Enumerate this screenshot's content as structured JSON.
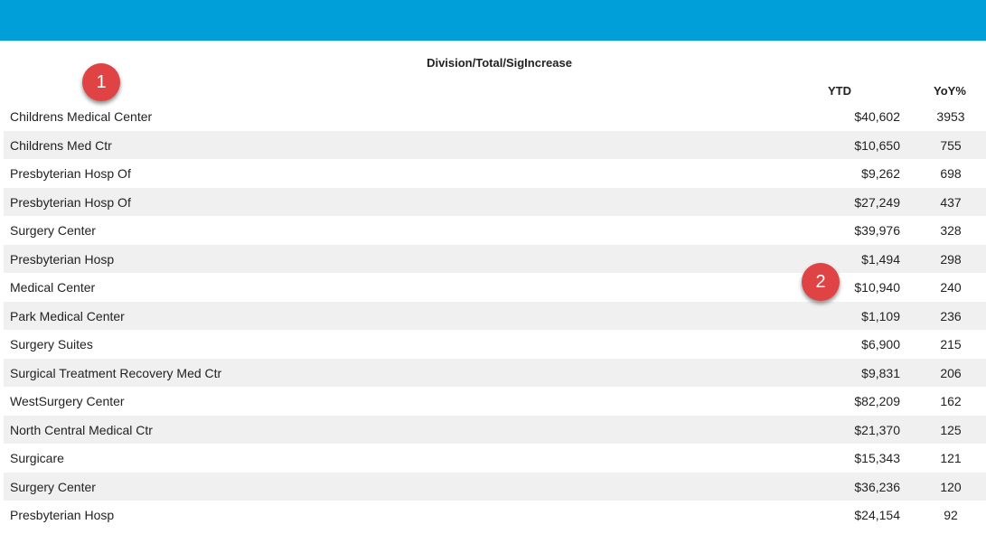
{
  "header_color": "#019fd9",
  "title": "Division/Total/SigIncrease",
  "columns": {
    "ytd": "YTD",
    "yoy": "YoY%"
  },
  "badges": [
    "1",
    "2"
  ],
  "rows": [
    {
      "name": "Childrens Medical Center",
      "ytd": "$40,602",
      "yoy": "3953"
    },
    {
      "name": "Childrens Med Ctr",
      "ytd": "$10,650",
      "yoy": "755"
    },
    {
      "name": "Presbyterian Hosp Of",
      "ytd": "$9,262",
      "yoy": "698"
    },
    {
      "name": "Presbyterian Hosp Of",
      "ytd": "$27,249",
      "yoy": "437"
    },
    {
      "name": "Surgery Center",
      "ytd": "$39,976",
      "yoy": "328"
    },
    {
      "name": "Presbyterian Hosp",
      "ytd": "$1,494",
      "yoy": "298"
    },
    {
      "name": "Medical Center",
      "ytd": "$10,940",
      "yoy": "240"
    },
    {
      "name": "Park Medical Center",
      "ytd": "$1,109",
      "yoy": "236"
    },
    {
      "name": "Surgery Suites",
      "ytd": "$6,900",
      "yoy": "215"
    },
    {
      "name": "Surgical Treatment Recovery Med Ctr",
      "ytd": "$9,831",
      "yoy": "206"
    },
    {
      "name": "WestSurgery Center",
      "ytd": "$82,209",
      "yoy": "162"
    },
    {
      "name": "North Central Medical Ctr",
      "ytd": "$21,370",
      "yoy": "125"
    },
    {
      "name": "Surgicare",
      "ytd": "$15,343",
      "yoy": "121"
    },
    {
      "name": "Surgery Center",
      "ytd": "$36,236",
      "yoy": "120"
    },
    {
      "name": "Presbyterian Hosp",
      "ytd": "$24,154",
      "yoy": "92"
    }
  ]
}
